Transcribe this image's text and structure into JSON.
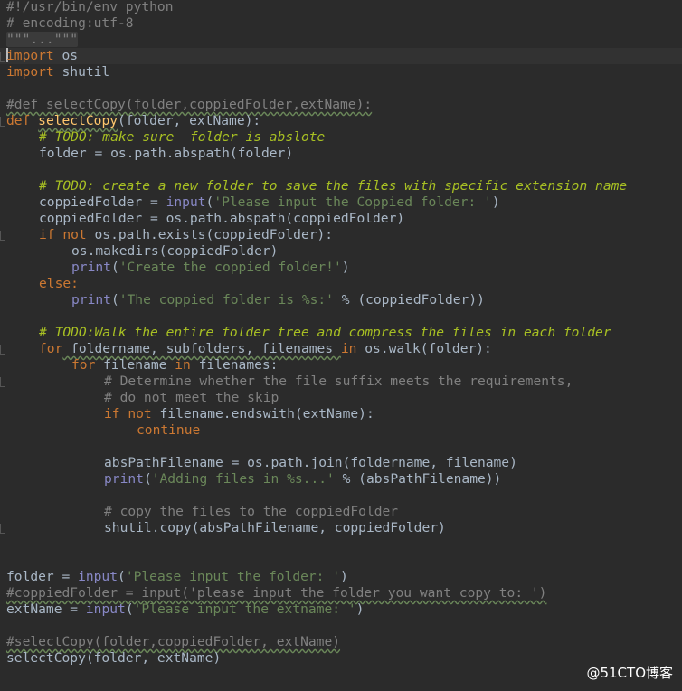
{
  "editor": {
    "l_shebang": "#!/usr/bin/env python",
    "l_encoding": "# encoding:utf-8",
    "l_docstring_fold": "\"\"\"...\"\"\"",
    "l_import1_kw": "import",
    "l_import1_mod": " os",
    "l_import2_kw": "import",
    "l_import2_mod": " shutil",
    "l_comment_def": "#def selectCopy(folder,coppiedFolder,extName):",
    "l_def_kw": "def",
    "l_def_name": "selectCopy",
    "l_def_args": "(folder, extName):",
    "l_todo1": "# TODO: make sure  folder is abslote",
    "l_folder_abspath": "folder = os.path.abspath(folder)",
    "l_todo2": "# TODO: create a new folder to save the files with specific extension name",
    "l_cf_lhs": "coppiedFolder = ",
    "l_cf_input": "input",
    "l_cf_open": "(",
    "l_cf_str": "'Please input the Coppied folder: '",
    "l_cf_close": ")",
    "l_cf_abspath": "coppiedFolder = os.path.abspath(coppiedFolder)",
    "l_if_kw": "if not",
    "l_if_rest": " os.path.exists(coppiedFolder):",
    "l_makedirs": "os.makedirs(coppiedFolder)",
    "l_print1_fn": "print",
    "l_print1_str": "'Create the coppied folder!'",
    "l_else": "else:",
    "l_print2_fn": "print",
    "l_print2_str": "'The coppied folder is %s:'",
    "l_print2_rest": " % (coppiedFolder))",
    "l_todo3": "# TODO:Walk the entire folder tree and compress the files in each folder",
    "l_for1_kw": "for",
    "l_for1_vars": " foldername, subfolders, filenames ",
    "l_for1_in": "in",
    "l_for1_rest": " os.walk(folder):",
    "l_for2_kw": "for",
    "l_for2_var": " filename ",
    "l_for2_in": "in",
    "l_for2_rest": " filenames:",
    "l_cmt_determine": "# Determine whether the file suffix meets the requirements,",
    "l_cmt_skip": "# do not meet the skip",
    "l_if2_kw": "if not",
    "l_if2_rest": " filename.endswith(extName):",
    "l_continue": "continue",
    "l_abs_join": "absPathFilename = os.path.join(foldername, filename)",
    "l_print3_fn": "print",
    "l_print3_str": "'Adding files in %s...'",
    "l_print3_rest": " % (absPathFilename))",
    "l_cmt_copy": "# copy the files to the coppiedFolder",
    "l_shutil_copy": "shutil.copy(absPathFilename, coppiedFolder)",
    "l_folder_lhs": "folder = ",
    "l_folder_input": "input",
    "l_folder_str": "'Please input the folder: '",
    "l_cmt_coppied": "#coppiedFolder = input('please input the folder you want copy to: ')",
    "l_ext_lhs": "extName = ",
    "l_ext_input": "input",
    "l_ext_str": "'Please input the extname: '",
    "l_cmt_select": "#selectCopy(folder,coppiedFolder, extName)",
    "l_call": "selectCopy(folder, extName)",
    "paren_open": "(",
    "paren_close": ")"
  },
  "watermark": "@51CTO博客",
  "colors": {
    "background": "#2b2b2b",
    "keyword": "#cc7832",
    "comment": "#808080",
    "todo": "#a8c023",
    "string": "#6a8759",
    "builtin": "#8888c6",
    "function_name": "#ffc66d",
    "text": "#a9b7c6"
  }
}
